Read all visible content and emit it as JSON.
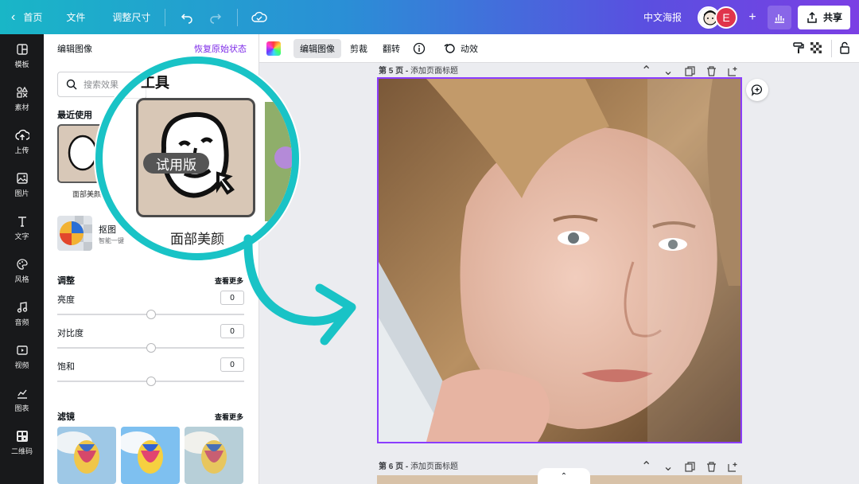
{
  "topbar": {
    "home": "首页",
    "file": "文件",
    "resize": "调整尺寸",
    "doc_title": "中文海报",
    "avatar_letter": "E",
    "share": "共享"
  },
  "leftnav": {
    "items": [
      {
        "label": "模板",
        "icon": "template-icon"
      },
      {
        "label": "素材",
        "icon": "elements-icon"
      },
      {
        "label": "上传",
        "icon": "upload-icon"
      },
      {
        "label": "图片",
        "icon": "image-icon"
      },
      {
        "label": "文字",
        "icon": "text-icon"
      },
      {
        "label": "风格",
        "icon": "palette-icon"
      },
      {
        "label": "音频",
        "icon": "audio-icon"
      },
      {
        "label": "视频",
        "icon": "video-icon"
      },
      {
        "label": "图表",
        "icon": "chart-icon"
      },
      {
        "label": "二维码",
        "icon": "qrcode-icon"
      }
    ]
  },
  "panel": {
    "title": "编辑图像",
    "reset": "恢复原始状态",
    "search_placeholder": "搜索效果",
    "recent_title": "最近使用",
    "recent_item": "面部美颜",
    "bg_title": "抠图",
    "bg_sub": "智能一键",
    "adjust_title": "调整",
    "see_more": "查看更多",
    "adjust": [
      {
        "label": "亮度",
        "value": "0"
      },
      {
        "label": "对比度",
        "value": "0"
      },
      {
        "label": "饱和",
        "value": "0"
      }
    ],
    "filters_title": "滤镜"
  },
  "magnifier": {
    "header_fragment": "工具",
    "badge": "试用版",
    "caption": "面部美颜"
  },
  "toolbar": {
    "edit_image": "编辑图像",
    "crop": "剪裁",
    "flip": "翻转",
    "animate": "动效"
  },
  "canvas": {
    "page5_num": "第 5 页 -",
    "page5_title": "添加页面标题",
    "page6_num": "第 6 页 -",
    "page6_title": "添加页面标题"
  },
  "colors": {
    "accent": "#8b3dff",
    "teal_callout": "#19c3c6"
  }
}
